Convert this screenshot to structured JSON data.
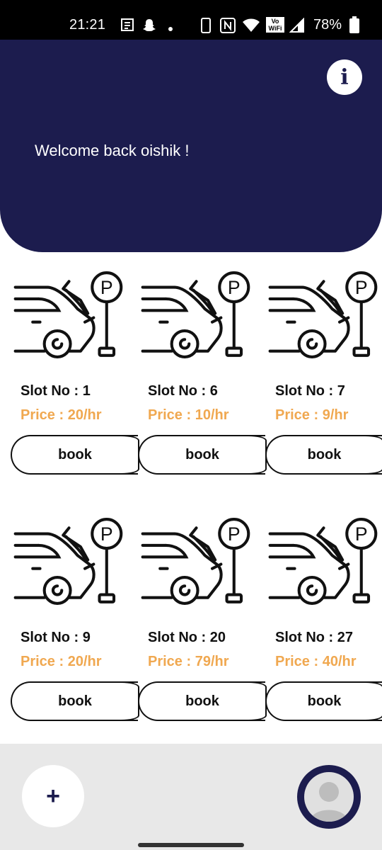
{
  "status_bar": {
    "time": "21:21",
    "battery": "78%",
    "icons": [
      "news-icon",
      "snapchat-icon",
      "dot-icon",
      "phone-icon",
      "nfc-icon",
      "wifi-icon",
      "vowifi-icon",
      "signal-icon",
      "battery-icon"
    ]
  },
  "header": {
    "welcome": "Welcome back oishik !",
    "info_icon": "i",
    "background": "#1c1c4e"
  },
  "slots": [
    {
      "slot": "Slot No : 1",
      "price": "Price : 20/hr",
      "book": "book"
    },
    {
      "slot": "Slot No : 6",
      "price": "Price : 10/hr",
      "book": "book"
    },
    {
      "slot": "Slot No : 7",
      "price": "Price : 9/hr",
      "book": "book"
    },
    {
      "slot": "Slot No : 9",
      "price": "Price : 20/hr",
      "book": "book"
    },
    {
      "slot": "Slot No : 20",
      "price": "Price : 79/hr",
      "book": "book"
    },
    {
      "slot": "Slot No : 27",
      "price": "Price : 40/hr",
      "book": "book"
    }
  ],
  "colors": {
    "accent": "#f0a850",
    "primary": "#1c1c4e"
  },
  "bottom_bar": {
    "add_label": "+"
  }
}
